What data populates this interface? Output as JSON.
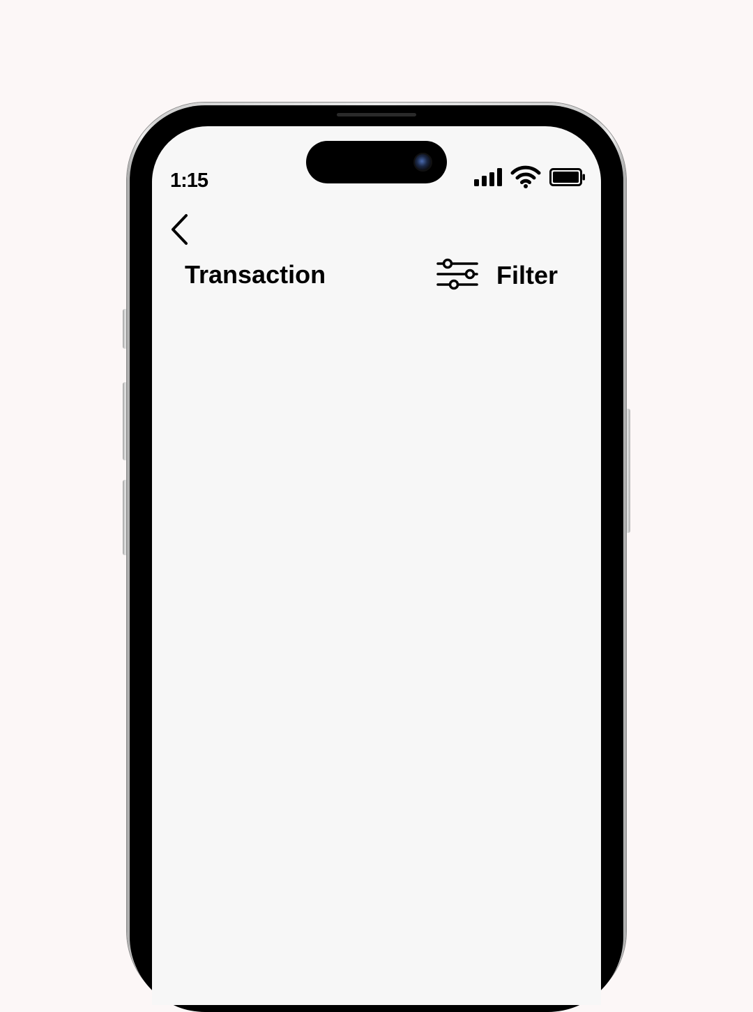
{
  "status_bar": {
    "time": "1:15",
    "icons": [
      "cellular-signal-icon",
      "wifi-icon",
      "battery-icon"
    ]
  },
  "nav": {
    "back_icon": "chevron-left-icon",
    "title": "Transaction",
    "filter": {
      "icon": "sliders-icon",
      "label": "Filter"
    }
  },
  "colors": {
    "page_background": "#fcf7f7",
    "screen_background": "#f7f7f7",
    "text": "#000000"
  }
}
